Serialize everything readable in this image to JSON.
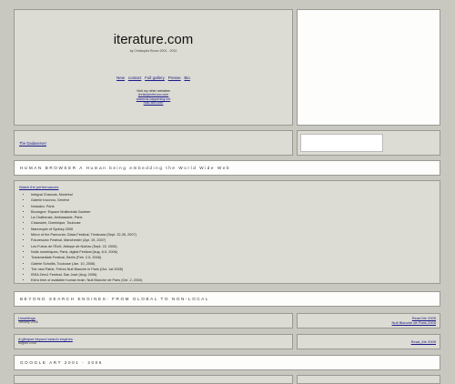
{
  "header": {
    "title": "iterature.com",
    "subtitle": "by Christophe Bruno 2001 - 2010",
    "nav": [
      "New",
      "contact",
      "Full gallery",
      "Presse",
      "Bio"
    ],
    "visit_label": "Visit my other websites",
    "sites": [
      "christophebruno.com",
      "adwords-happening.net",
      "hulu-wiki.com"
    ]
  },
  "row2": {
    "left_text": "The Dadaserver"
  },
  "banner1": "HUMAN BROWSER A Human being embedding the World Wide Web",
  "performances": {
    "title": "Watch the performances",
    "items": [
      "Intégral Chamois, Montréal",
      "Galerie Inconnu, Genève",
      "Noisalon, Paris",
      "Bourogne: Espace Multimédia Gantner",
      "La Chatheuse, Ambassade, Paris",
      "Chaussée, Dominique, Toulouse",
      "Mannequin of Sydney 2006",
      "Mirror of the Pannonia: Glass Festival, Timisoara (Sept. 22-26, 2007)",
      "Futuresonic Festival, Manchester (Apr. 19, 2007)",
      "Les Futurs de l'Écrit, Abbaye de Noirlac (Sept. 22, 2006)",
      "Nuits numériques, Paris, digital Festival (Aug. 8-9, 2006)",
      "Transmediale Festival, Berlin (Feb. 2-5, 2006)",
      "Galerie Scholtis, Toulouse (Jan. 10, 2006)",
      "The new Patrie, Frères Nuit Blanche in Paris (Oct. 1st 2005)",
      "ISEA Zero1 Festival, San José (Aug. 2006)",
      "Extra time of available human brain: Nuit Blanche de Paris (Oct. 2, 2004)"
    ]
  },
  "banner2": "BEYOND SEARCH ENGINES: FROM GLOBAL TO NON-LOCAL",
  "rows": [
    {
      "left_link": "Unsettings",
      "left_sub": "January 2006",
      "right_line1": "Read Me 2005",
      "right_line2": "Nuit Blanche de Paris 2005"
    },
    {
      "left_link": "A glimpse beyond search engines",
      "left_sub": "august 2006",
      "right_line1": "Read_Me 2005",
      "right_line2": ""
    }
  ],
  "banner3": "GOOGLE ART 2001 - 2006"
}
